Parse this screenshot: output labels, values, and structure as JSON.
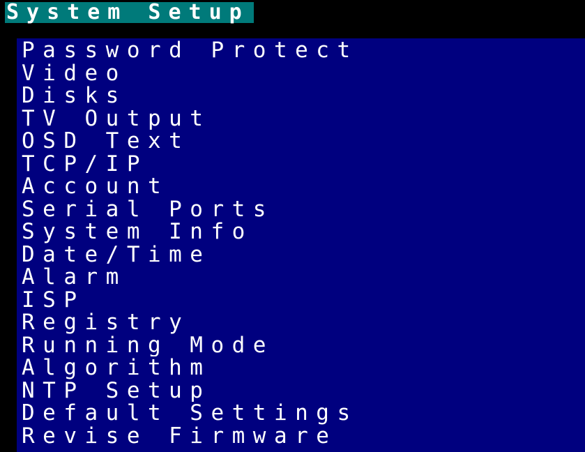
{
  "window": {
    "title": "System Setup"
  },
  "menu": {
    "items": [
      {
        "label": "Password Protect"
      },
      {
        "label": "Video"
      },
      {
        "label": "Disks"
      },
      {
        "label": "TV Output"
      },
      {
        "label": "OSD Text"
      },
      {
        "label": "TCP/IP"
      },
      {
        "label": "Account"
      },
      {
        "label": "Serial Ports"
      },
      {
        "label": "System Info"
      },
      {
        "label": "Date/Time"
      },
      {
        "label": "Alarm"
      },
      {
        "label": "ISP"
      },
      {
        "label": "Registry"
      },
      {
        "label": "Running Mode"
      },
      {
        "label": "Algorithm"
      },
      {
        "label": "NTP Setup"
      },
      {
        "label": "Default Settings"
      },
      {
        "label": "Revise Firmware"
      }
    ]
  },
  "colors": {
    "screen_background": "#000000",
    "title_background": "#007a7a",
    "menu_background": "#00007f",
    "text": "#ffffff"
  }
}
